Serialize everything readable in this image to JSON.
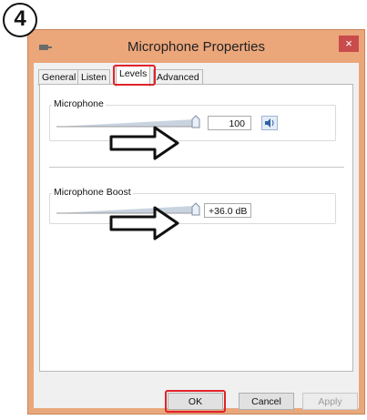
{
  "step_number": "4",
  "window": {
    "title": "Microphone Properties",
    "close_glyph": "×",
    "icon": "microphone-icon"
  },
  "tabs": [
    {
      "label": "General",
      "active": false
    },
    {
      "label": "Listen",
      "active": false
    },
    {
      "label": "Levels",
      "active": true
    },
    {
      "label": "Advanced",
      "active": false
    }
  ],
  "levels": {
    "microphone": {
      "label": "Microphone",
      "value": "100",
      "mute_icon": "speaker-icon"
    },
    "boost": {
      "label": "Microphone Boost",
      "value": "+36.0 dB"
    }
  },
  "buttons": {
    "ok": "OK",
    "cancel": "Cancel",
    "apply": "Apply"
  },
  "colors": {
    "highlight": "#e0232a",
    "titlebar": "#eba67a"
  }
}
